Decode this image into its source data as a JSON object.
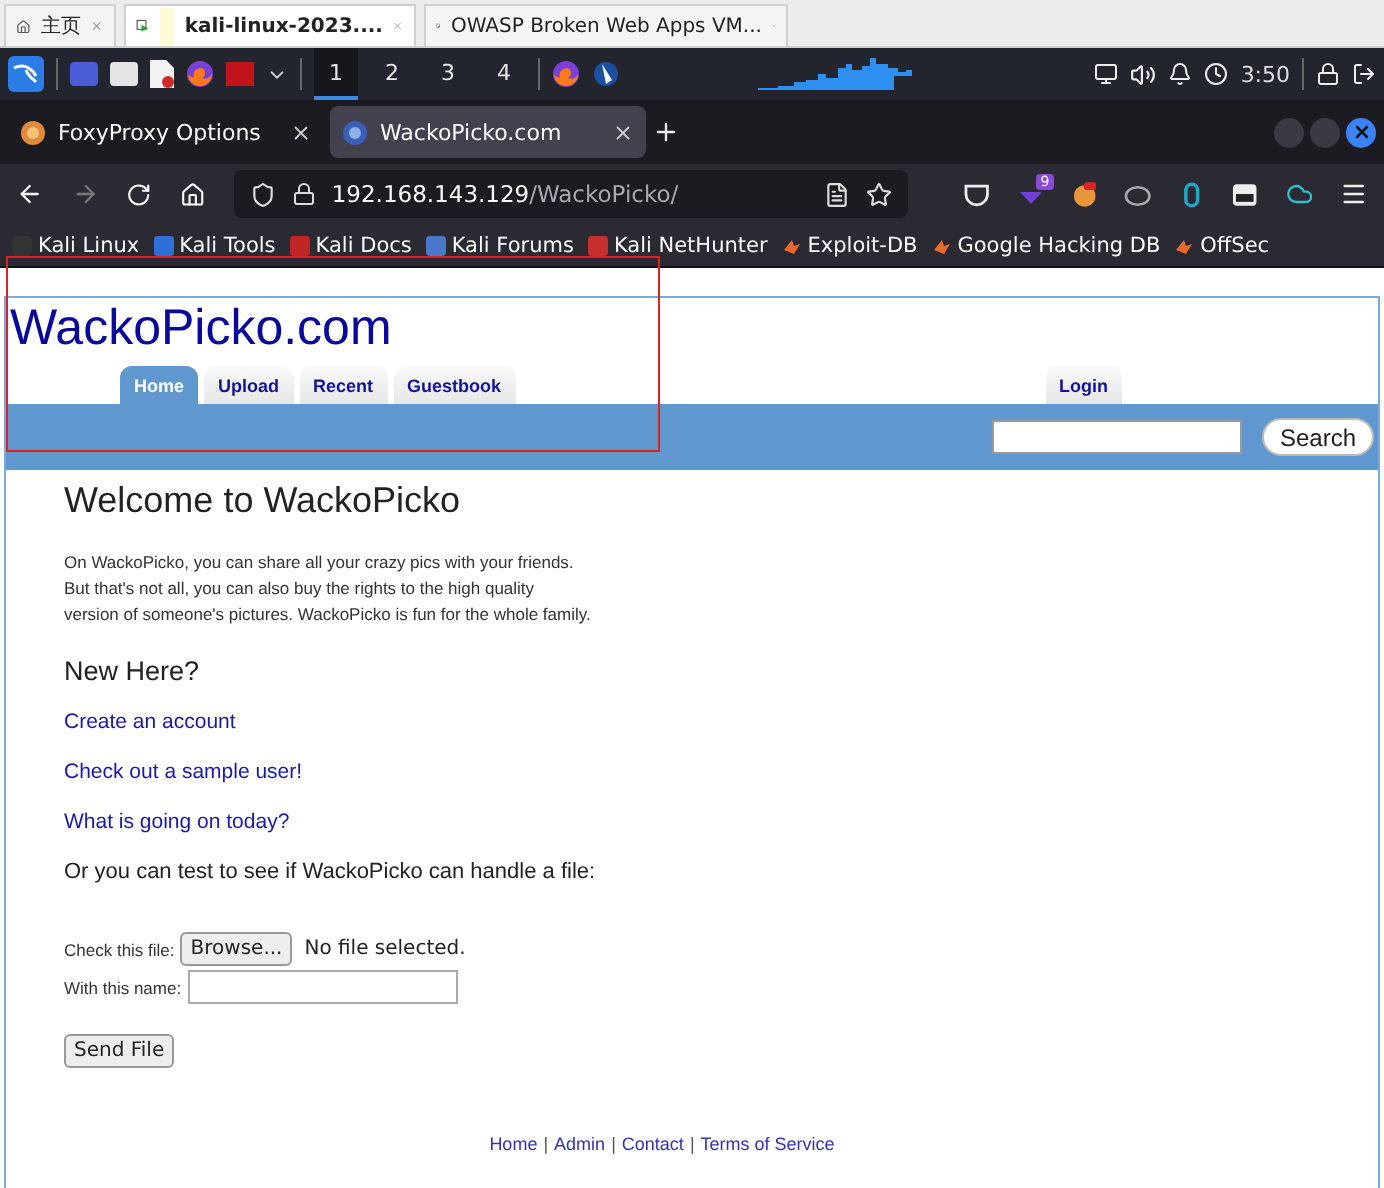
{
  "vm_tabs": [
    {
      "label": "主页",
      "selected": false,
      "kind": "home"
    },
    {
      "label": "kali-linux-2023....",
      "selected": true,
      "kind": "vm"
    },
    {
      "label": "OWASP Broken Web Apps VM...",
      "selected": false,
      "kind": "vm"
    }
  ],
  "taskbar": {
    "workspaces": [
      {
        "label": "1",
        "selected": true
      },
      {
        "label": "2",
        "selected": false
      },
      {
        "label": "3",
        "selected": false
      },
      {
        "label": "4",
        "selected": false
      }
    ],
    "clock": "3:50"
  },
  "browser_tabs": [
    {
      "label": "FoxyProxy Options",
      "selected": false
    },
    {
      "label": "WackoPicko.com",
      "selected": true
    }
  ],
  "address": {
    "host": "192.168.143.129",
    "path": "/WackoPicko/"
  },
  "extension_badge": "9",
  "bookmarks": [
    "Kali Linux",
    "Kali Tools",
    "Kali Docs",
    "Kali Forums",
    "Kali NetHunter",
    "Exploit-DB",
    "Google Hacking DB",
    "OffSec"
  ],
  "site": {
    "title": "WackoPicko.com",
    "nav": [
      {
        "label": "Home",
        "selected": true
      },
      {
        "label": "Upload",
        "selected": false
      },
      {
        "label": "Recent",
        "selected": false
      },
      {
        "label": "Guestbook",
        "selected": false
      }
    ],
    "login": {
      "label": "Login",
      "selected": false
    },
    "search_button": "Search"
  },
  "content": {
    "heading": "Welcome to WackoPicko",
    "intro_lines": [
      "On WackoPicko, you can share all your crazy pics with your friends.",
      "But that's not all, you can also buy the rights to the high quality",
      "version of someone's pictures. WackoPicko is fun for the whole family."
    ],
    "new_here": "New Here?",
    "links": [
      "Create an account",
      "Check out a sample user!",
      "What is going on today?"
    ],
    "file_prompt": "Or you can test to see if WackoPicko can handle a file:",
    "file_label": "Check this file:",
    "browse_button": "Browse...",
    "no_file": "No file selected.",
    "name_label": "With this name:",
    "send_button": "Send File"
  },
  "footer": {
    "links": [
      "Home",
      "Admin",
      "Contact",
      "Terms of Service"
    ],
    "separator": "|"
  }
}
